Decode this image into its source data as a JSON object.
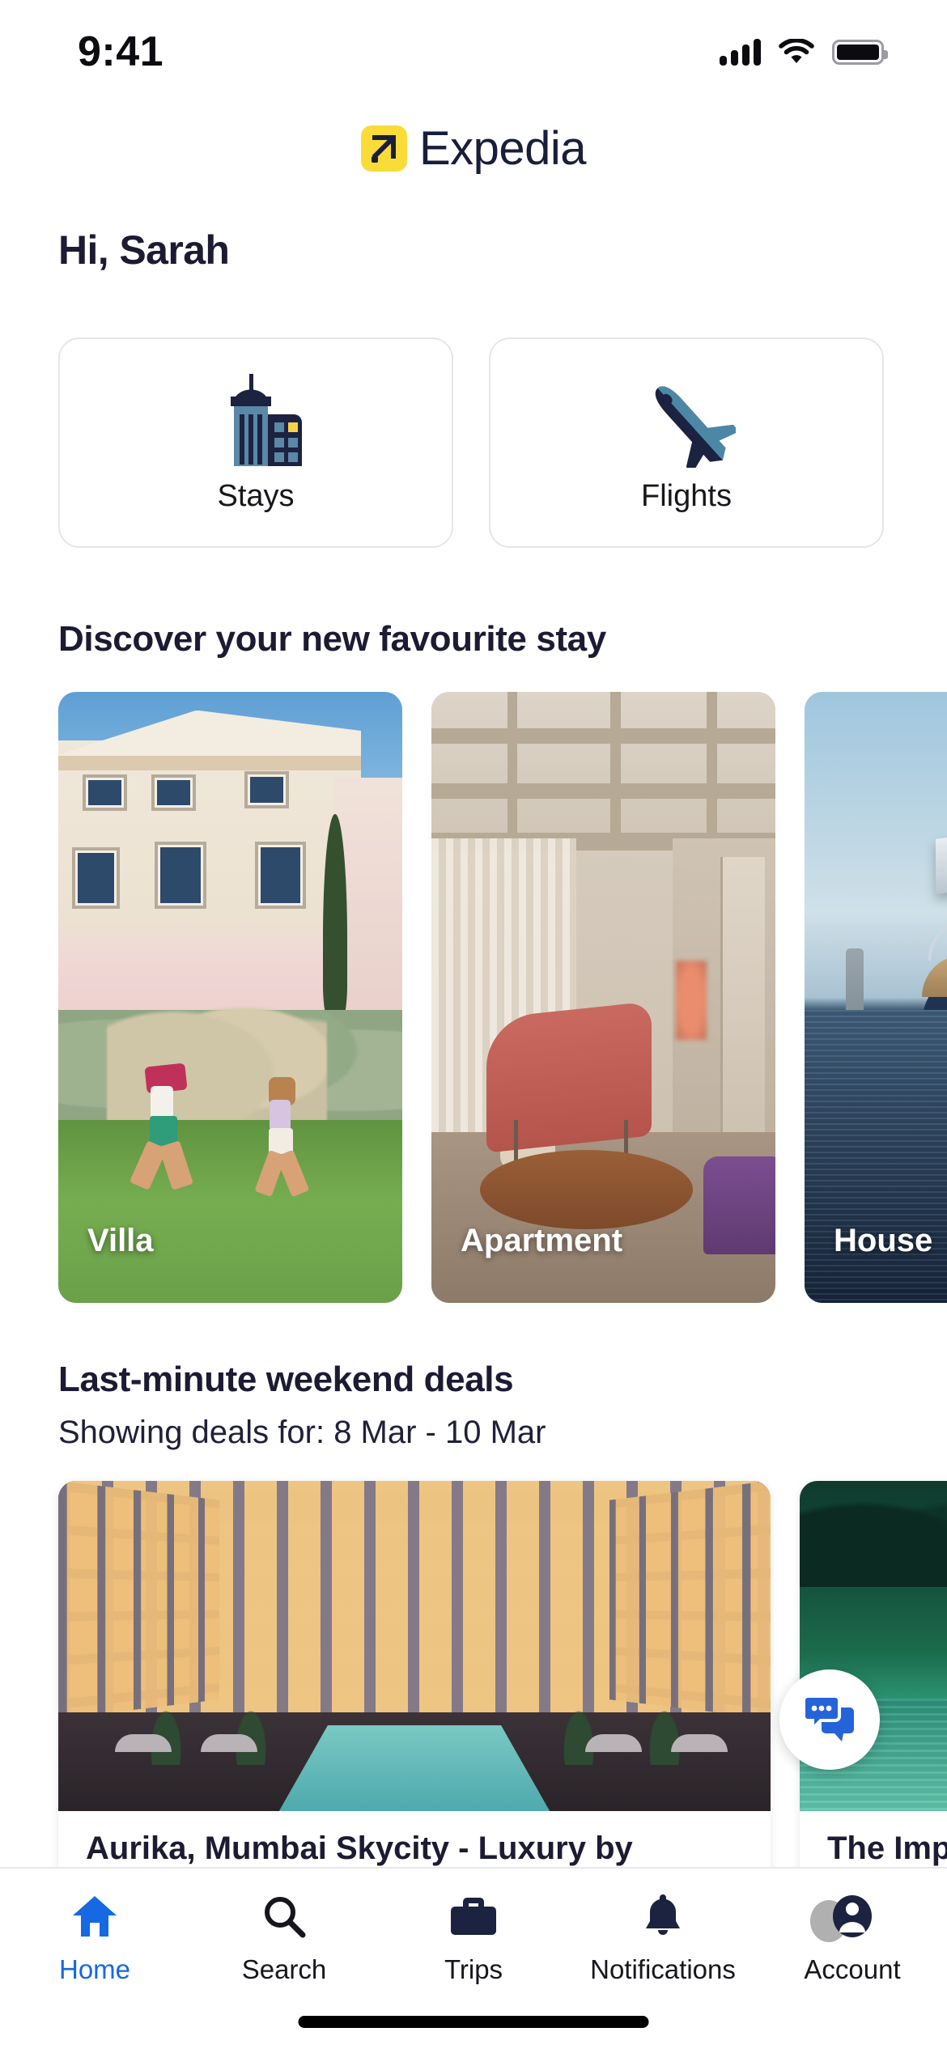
{
  "status_bar": {
    "time": "9:41",
    "cellular_icon": "cellular-bars-icon",
    "wifi_icon": "wifi-icon",
    "battery_icon": "battery-full-icon"
  },
  "header": {
    "brand_name": "Expedia",
    "logo_icon": "expedia-arrow-logo",
    "brand_yellow": "#f9dc37",
    "brand_navy": "#191e3b"
  },
  "greeting": {
    "text": "Hi, Sarah"
  },
  "quick_actions": [
    {
      "label": "Stays",
      "icon": "buildings-icon"
    },
    {
      "label": "Flights",
      "icon": "airplane-icon"
    }
  ],
  "discover": {
    "title": "Discover your new favourite stay",
    "cards": [
      {
        "caption": "Villa",
        "image": "villa-garden-children-photo"
      },
      {
        "caption": "Apartment",
        "image": "apartment-interior-lounge-photo"
      },
      {
        "caption": "House",
        "image": "houseboat-on-water-photo"
      }
    ]
  },
  "deals": {
    "title": "Last-minute weekend deals",
    "subtitle": "Showing deals for: 8 Mar - 10 Mar",
    "cards": [
      {
        "name": "Aurika, Mumbai Skycity - Luxury by",
        "image": "hotel-atrium-pool-photo"
      },
      {
        "name": "The Imp",
        "image": "beach-resort-photo"
      }
    ]
  },
  "chat_fab": {
    "icon": "chat-bubbles-icon",
    "color": "#2563d9"
  },
  "bottom_nav": {
    "active_color": "#1668e3",
    "inactive_color": "#16161c",
    "items": [
      {
        "label": "Home",
        "icon": "home-icon",
        "active": true
      },
      {
        "label": "Search",
        "icon": "search-icon",
        "active": false
      },
      {
        "label": "Trips",
        "icon": "briefcase-icon",
        "active": false
      },
      {
        "label": "Notifications",
        "icon": "bell-icon",
        "active": false
      },
      {
        "label": "Account",
        "icon": "person-circle-icon",
        "active": false
      }
    ]
  }
}
